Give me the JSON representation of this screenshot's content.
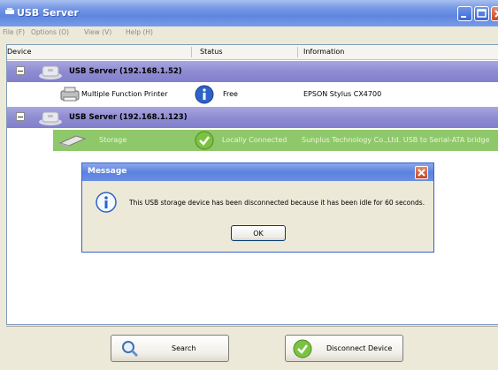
{
  "window": {
    "title": "USB Server"
  },
  "menu": [
    "File (F)",
    "Options (O)",
    "View (V)",
    "Help (H)"
  ],
  "columns": {
    "device": "Device",
    "status": "Status",
    "information": "Information"
  },
  "groups": [
    {
      "label": "USB Server (192.168.1.52)",
      "devices": [
        {
          "name": "Multiple Function Printer",
          "status": "Free",
          "information": "EPSON Stylus CX4700",
          "icon": "printer-icon",
          "status_icon": "info-icon"
        }
      ]
    },
    {
      "label": "USB Server (192.168.1.123)",
      "devices": [
        {
          "name": "Storage",
          "status": "Locally Connected",
          "information": "Sunplus Technology Co.,Ltd. USB to Serial-ATA bridge",
          "icon": "storage-icon",
          "status_icon": "check-icon",
          "highlight_color": "#8fc86a"
        }
      ]
    }
  ],
  "dialog": {
    "title": "Message",
    "message": "This USB storage device has been disconnected because it has been idle for 60 seconds.",
    "ok_label": "OK"
  },
  "buttons": {
    "search": "Search",
    "disconnect": "Disconnect Device"
  },
  "colors": {
    "title_bar": "#5f86df",
    "group_row": "#8f8cd3",
    "connected_row": "#8fc86a",
    "info_blue": "#2d63c8",
    "check_green": "#7cc242"
  }
}
